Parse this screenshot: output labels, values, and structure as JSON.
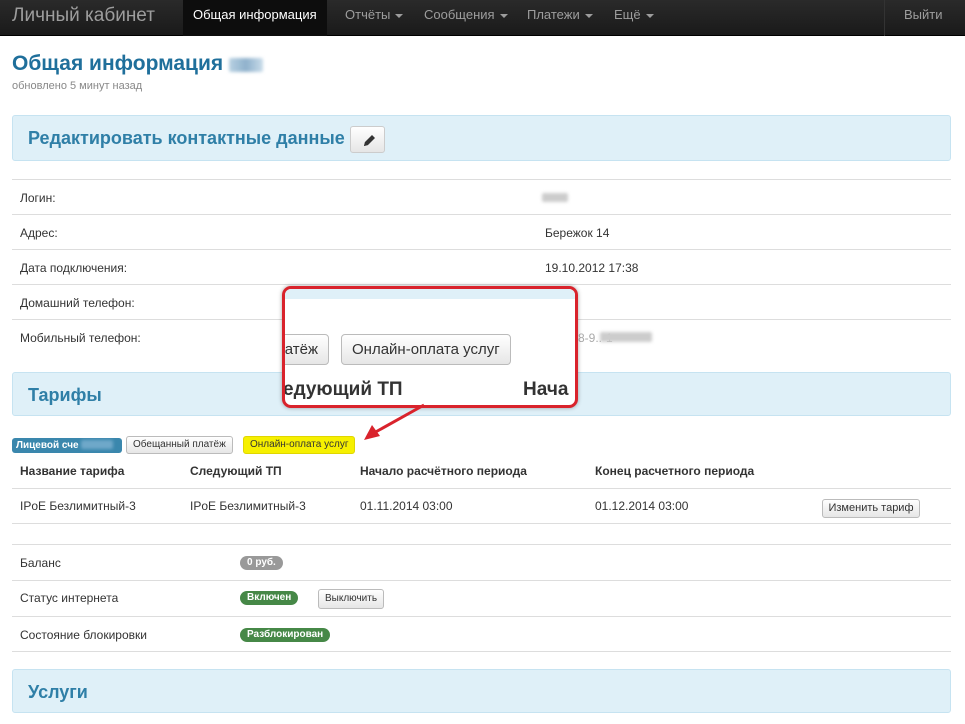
{
  "navbar": {
    "brand": "Личный кабинет",
    "items": [
      {
        "label": "Общая информация"
      },
      {
        "label": "Отчёты"
      },
      {
        "label": "Сообщения"
      },
      {
        "label": "Платежи"
      },
      {
        "label": "Ещё"
      }
    ],
    "logout": "Выйти"
  },
  "header": {
    "title": "Общая информация",
    "updated": "обновлено 5 минут назад"
  },
  "contacts": {
    "title": "Редактировать контактные данные",
    "rows": [
      {
        "label": "Логин:",
        "value": ""
      },
      {
        "label": "Адрес:",
        "value": "Бережок 14"
      },
      {
        "label": "Дата подключения:",
        "value": "19.10.2012 17:38"
      },
      {
        "label": "Домашний телефон:",
        "value": ""
      },
      {
        "label": "Мобильный телефон:",
        "value": ""
      }
    ]
  },
  "tariffs": {
    "title": "Тарифы",
    "account_label": "Лицевой сче",
    "promised_payment": "Обещанный платёж",
    "online_payment": "Онлайн-оплата услуг",
    "columns": [
      "Название тарифа",
      "Следующий ТП",
      "Начало расчётного периода",
      "Конец расчетного периода"
    ],
    "row": [
      "IPoE Безлимитный-3",
      "IPoE Безлимитный-3",
      "01.11.2014 03:00",
      "01.12.2014 03:00"
    ],
    "change_button": "Изменить тариф"
  },
  "status": {
    "balance_label": "Баланс",
    "balance_value": "0 руб.",
    "internet_label": "Статус интернета",
    "internet_value": "Включен",
    "disable_button": "Выключить",
    "block_label": "Состояние блокировки",
    "block_value": "Разблокирован"
  },
  "services": {
    "title": "Услуги"
  },
  "callout": {
    "partial_button": "латёж",
    "button": "Онлайн-оплата услуг",
    "col_left": "едующий ТП",
    "col_right": "Нача",
    "phone_fragment": "8-9..-1"
  },
  "colors": {
    "accent": "#2f7fa7",
    "callout_border": "#d9232c",
    "highlight": "#f6f000"
  }
}
